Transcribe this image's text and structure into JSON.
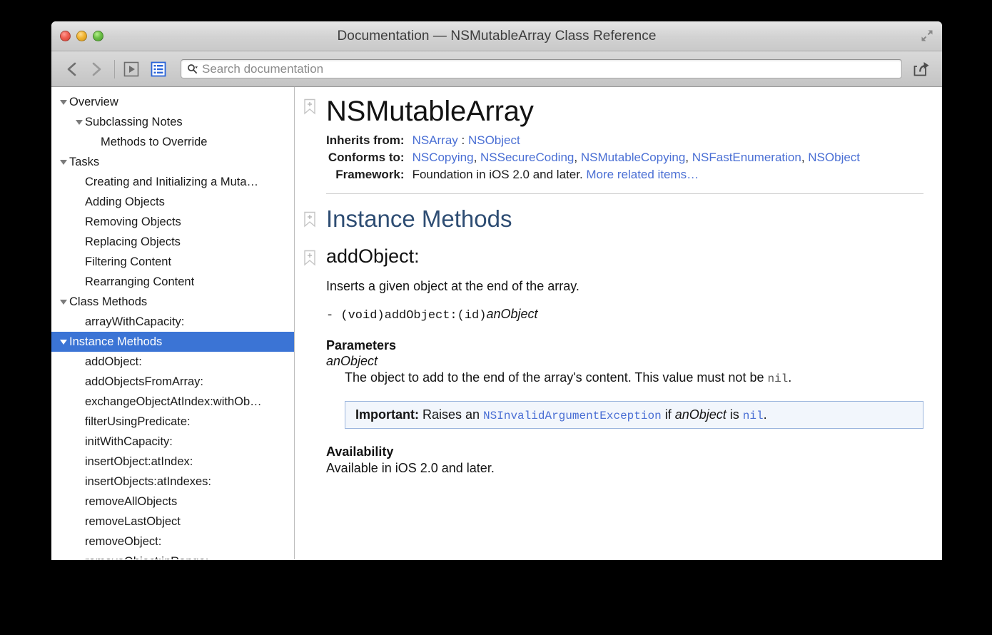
{
  "window": {
    "title": "Documentation — NSMutableArray Class Reference",
    "controls": {
      "close": "close",
      "minimize": "minimize",
      "maximize": "maximize"
    },
    "fullscreen_icon": "fullscreen-icon"
  },
  "toolbar": {
    "back_icon": "back-chevron-icon",
    "forward_icon": "forward-chevron-icon",
    "run_icon": "play-button-icon",
    "list_icon": "table-of-contents-icon",
    "share_icon": "share-icon",
    "search": {
      "placeholder": "Search documentation",
      "value": "",
      "icon": "search-icon"
    }
  },
  "colors": {
    "selection_blue": "#3b74d5",
    "link_blue": "#4a6fd4",
    "heading_blue": "#2e4d73",
    "callout_border": "#9bb5dd",
    "callout_bg": "#f2f6fc"
  },
  "sidebar": {
    "items": [
      {
        "label": "Overview",
        "indent": 0,
        "disclosure": "open",
        "selected": false
      },
      {
        "label": "Subclassing Notes",
        "indent": 1,
        "disclosure": "open",
        "selected": false
      },
      {
        "label": "Methods to Override",
        "indent": 2,
        "disclosure": "none",
        "selected": false
      },
      {
        "label": "Tasks",
        "indent": 0,
        "disclosure": "open",
        "selected": false
      },
      {
        "label": "Creating and Initializing a Muta…",
        "indent": 1,
        "disclosure": "none",
        "selected": false
      },
      {
        "label": "Adding Objects",
        "indent": 1,
        "disclosure": "none",
        "selected": false
      },
      {
        "label": "Removing Objects",
        "indent": 1,
        "disclosure": "none",
        "selected": false
      },
      {
        "label": "Replacing Objects",
        "indent": 1,
        "disclosure": "none",
        "selected": false
      },
      {
        "label": "Filtering Content",
        "indent": 1,
        "disclosure": "none",
        "selected": false
      },
      {
        "label": "Rearranging Content",
        "indent": 1,
        "disclosure": "none",
        "selected": false
      },
      {
        "label": "Class Methods",
        "indent": 0,
        "disclosure": "open",
        "selected": false
      },
      {
        "label": "arrayWithCapacity:",
        "indent": 1,
        "disclosure": "none",
        "selected": false
      },
      {
        "label": "Instance Methods",
        "indent": 0,
        "disclosure": "open",
        "selected": true
      },
      {
        "label": "addObject:",
        "indent": 1,
        "disclosure": "none",
        "selected": false
      },
      {
        "label": "addObjectsFromArray:",
        "indent": 1,
        "disclosure": "none",
        "selected": false
      },
      {
        "label": "exchangeObjectAtIndex:withOb…",
        "indent": 1,
        "disclosure": "none",
        "selected": false
      },
      {
        "label": "filterUsingPredicate:",
        "indent": 1,
        "disclosure": "none",
        "selected": false
      },
      {
        "label": "initWithCapacity:",
        "indent": 1,
        "disclosure": "none",
        "selected": false
      },
      {
        "label": "insertObject:atIndex:",
        "indent": 1,
        "disclosure": "none",
        "selected": false
      },
      {
        "label": "insertObjects:atIndexes:",
        "indent": 1,
        "disclosure": "none",
        "selected": false
      },
      {
        "label": "removeAllObjects",
        "indent": 1,
        "disclosure": "none",
        "selected": false
      },
      {
        "label": "removeLastObject",
        "indent": 1,
        "disclosure": "none",
        "selected": false
      },
      {
        "label": "removeObject:",
        "indent": 1,
        "disclosure": "none",
        "selected": false
      },
      {
        "label": "removeObject:inRange:",
        "indent": 1,
        "disclosure": "none",
        "selected": false
      }
    ]
  },
  "content": {
    "class_title": "NSMutableArray",
    "bookmark_icon": "bookmark-add-icon",
    "meta": [
      {
        "key": "Inherits from:",
        "parts": [
          {
            "text": "NSArray",
            "link": true
          },
          {
            "text": " : ",
            "link": false
          },
          {
            "text": "NSObject",
            "link": true
          }
        ]
      },
      {
        "key": "Conforms to:",
        "parts": [
          {
            "text": "NSCopying",
            "link": true
          },
          {
            "text": ", ",
            "link": false
          },
          {
            "text": "NSSecureCoding",
            "link": true
          },
          {
            "text": ", ",
            "link": false
          },
          {
            "text": "NSMutableCopying",
            "link": true
          },
          {
            "text": ", ",
            "link": false
          },
          {
            "text": "NSFastEnumeration",
            "link": true
          },
          {
            "text": ", ",
            "link": false
          },
          {
            "text": "NSObject",
            "link": true
          }
        ]
      },
      {
        "key": "Framework:",
        "parts": [
          {
            "text": "Foundation in iOS 2.0 and later. ",
            "link": false
          },
          {
            "text": "More related items…",
            "link": true
          }
        ]
      }
    ],
    "section_title": "Instance Methods",
    "method": {
      "title": "addObject:",
      "abstract": "Inserts a given object at the end of the array.",
      "declaration_prefix": "- (void)addObject:(id)",
      "declaration_param": "anObject",
      "parameters_heading": "Parameters",
      "parameter_name": "anObject",
      "parameter_desc_before": "The object to add to the end of the array's content. This value must not be ",
      "parameter_desc_code": "nil",
      "parameter_desc_after": ".",
      "important": {
        "label": "Important:",
        "before_code": " Raises an ",
        "code": "NSInvalidArgumentException",
        "mid": " if ",
        "italic": "anObject",
        "after_italic": " is ",
        "code2": "nil",
        "tail": "."
      },
      "availability_heading": "Availability",
      "availability_text": "Available in iOS 2.0 and later."
    }
  }
}
